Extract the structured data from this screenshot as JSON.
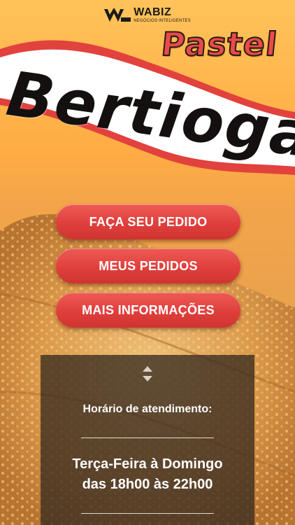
{
  "brand": {
    "name": "WABIZ",
    "tagline": "NEGÓCIOS INTELIGENTES"
  },
  "banner": {
    "title_top": "Pastel",
    "title_main": "Bertioga"
  },
  "menu": [
    {
      "label": "FAÇA SEU PEDIDO"
    },
    {
      "label": "MEUS PEDIDOS"
    },
    {
      "label": "MAIS INFORMAÇÕES"
    }
  ],
  "info": {
    "heading": "Horário de atendimento:",
    "days": "Terça-Feira à Domingo",
    "hours": "das 18h00 às 22h00"
  },
  "colors": {
    "accent_red": "#e03f3c",
    "background_orange": "#ffad44",
    "panel": "#372a20"
  }
}
